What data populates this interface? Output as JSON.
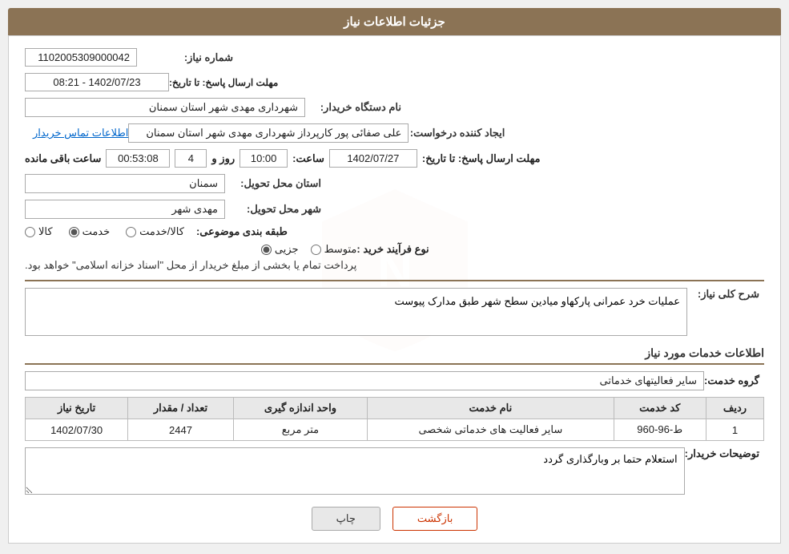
{
  "header": {
    "title": "جزئیات اطلاعات نیاز"
  },
  "fields": {
    "need_number_label": "شماره نیاز:",
    "need_number_value": "1102005309000042",
    "buyer_org_label": "نام دستگاه خریدار:",
    "buyer_org_value": "شهرداری مهدی شهر استان سمنان",
    "creator_label": "ایجاد کننده درخواست:",
    "creator_value": "علی صفائی پور کارپرداز شهرداری مهدی شهر استان سمنان",
    "contact_link": "اطلاعات تماس خریدار",
    "deadline_label": "مهلت ارسال پاسخ: تا تاریخ:",
    "deadline_date": "1402/07/27",
    "deadline_time_label": "ساعت:",
    "deadline_time": "10:00",
    "deadline_days_label": "روز و",
    "deadline_days": "4",
    "countdown_label": "ساعت باقی مانده",
    "countdown_value": "00:53:08",
    "province_label": "استان محل تحویل:",
    "province_value": "سمنان",
    "city_label": "شهر محل تحویل:",
    "city_value": "مهدی شهر",
    "category_label": "طبقه بندی موضوعی:",
    "category_options": [
      "کالا",
      "خدمت",
      "کالا/خدمت"
    ],
    "category_selected": "خدمت",
    "process_label": "نوع فرآیند خرید :",
    "process_options": [
      "جزیی",
      "متوسط"
    ],
    "process_text": "پرداخت تمام یا بخشی از مبلغ خریدار از محل \"اسناد خزانه اسلامی\" خواهد بود.",
    "general_desc_label": "شرح کلی نیاز:",
    "general_desc_value": "عملیات خرد عمرانی پارکهاو میادین سطح شهر طبق مدارک پیوست",
    "services_title": "اطلاعات خدمات مورد نیاز",
    "service_group_label": "گروه خدمت:",
    "service_group_value": "سایر فعالیتهای خدماتی",
    "table": {
      "headers": [
        "ردیف",
        "کد خدمت",
        "نام خدمت",
        "واحد اندازه گیری",
        "تعداد / مقدار",
        "تاریخ نیاز"
      ],
      "rows": [
        {
          "index": "1",
          "code": "ط-96-960",
          "name": "سایر فعالیت های خدماتی شخصی",
          "unit": "متر مربع",
          "quantity": "2447",
          "date": "1402/07/30"
        }
      ]
    },
    "buyer_desc_label": "توضیحات خریدار:",
    "buyer_desc_value": "استعلام حتما بر وبارگذاری گردد"
  },
  "buttons": {
    "print": "چاپ",
    "back": "بازگشت"
  }
}
